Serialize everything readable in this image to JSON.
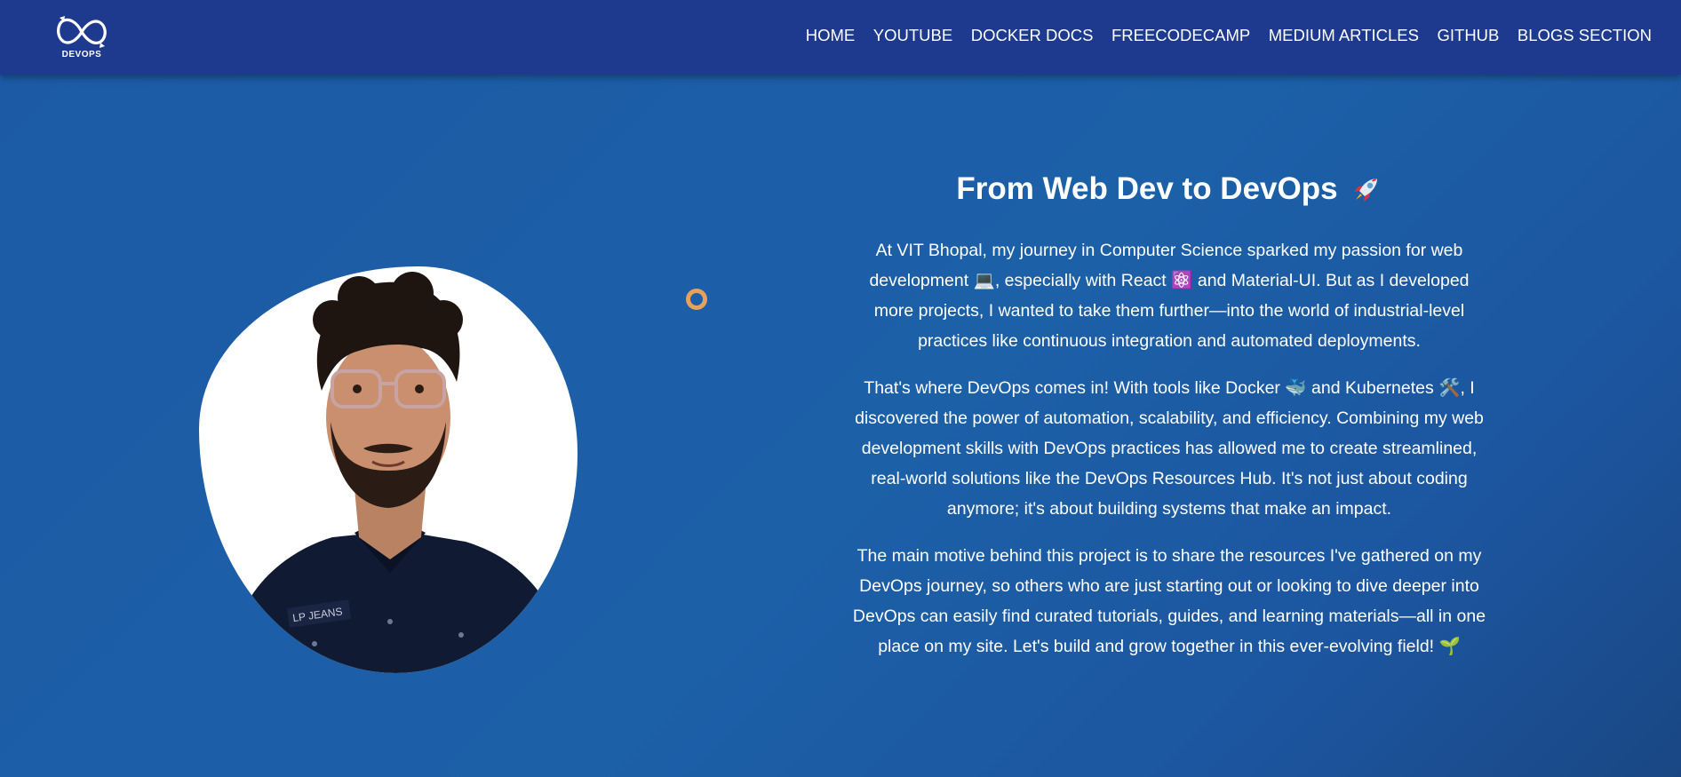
{
  "brand": {
    "logo_text": "DEVOPS",
    "icon": "infinity-loop-logo"
  },
  "nav": {
    "items": [
      {
        "label": "HOME"
      },
      {
        "label": "YOUTUBE"
      },
      {
        "label": "DOCKER DOCS"
      },
      {
        "label": "FREECODECAMP"
      },
      {
        "label": "MEDIUM ARTICLES"
      },
      {
        "label": "GITHUB"
      },
      {
        "label": "BLOGS SECTION"
      }
    ]
  },
  "hero": {
    "title": "From Web Dev to DevOps",
    "title_emoji": "🚀",
    "paragraphs": [
      {
        "text_a": "At VIT Bhopal, my journey in Computer Science sparked my passion for web development ",
        "emoji_a": "💻",
        "text_b": ", especially with React ",
        "emoji_b": "⚛️",
        "text_c": " and Material-UI. But as I developed more projects, I wanted to take them further—into the world of industrial-level practices like continuous integration and automated deployments."
      },
      {
        "text_a": "That's where DevOps comes in! With tools like Docker ",
        "emoji_a": "🐳",
        "text_b": " and Kubernetes ",
        "emoji_b": "🛠️",
        "text_c": ", I discovered the power of automation, scalability, and efficiency. Combining my web development skills with DevOps practices has allowed me to create streamlined, real-world solutions like the DevOps Resources Hub. It's not just about coding anymore; it's about building systems that make an impact."
      },
      {
        "text_a": "The main motive behind this project is to share the resources I've gathered on my DevOps journey, so others who are just starting out or looking to dive deeper into DevOps can easily find curated tutorials, guides, and learning materials—all in one place on my site. Let's build and grow together in this ever-evolving field! ",
        "emoji_a": "🌱"
      }
    ]
  },
  "colors": {
    "navbar": "#1d3a8f",
    "background": "#1c5ea7",
    "accent_ring": "#e6a25a",
    "text": "#ffffff"
  }
}
